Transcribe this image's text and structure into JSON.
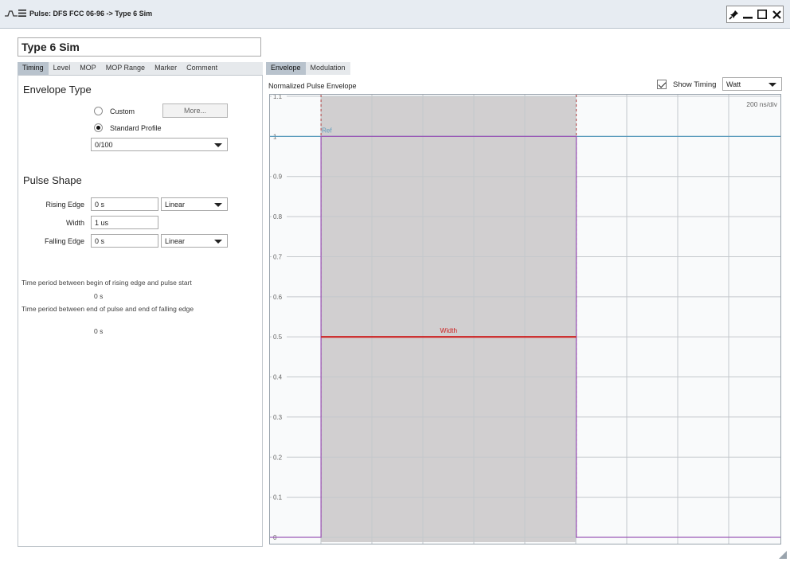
{
  "window": {
    "title": "Pulse: DFS FCC 06-96 -> Type 6 Sim",
    "icons": [
      "pulse-icon",
      "menu-icon",
      "pin-icon",
      "minimize-icon",
      "maximize-icon",
      "close-icon"
    ]
  },
  "pulse_name": "Type 6 Sim",
  "left_tabs": [
    "Timing",
    "Level",
    "MOP",
    "MOP Range",
    "Marker",
    "Comment"
  ],
  "envelope_type": {
    "heading": "Envelope Type",
    "custom_label": "Custom",
    "more_button": "More...",
    "standard_label": "Standard Profile",
    "selected": "Standard Profile",
    "profile_value": "0/100"
  },
  "pulse_shape": {
    "heading": "Pulse Shape",
    "rising_label": "Rising Edge",
    "rising_value": "0 s",
    "rising_shape": "Linear",
    "width_label": "Width",
    "width_value": "1 us",
    "falling_label": "Falling Edge",
    "falling_value": "0 s",
    "falling_shape": "Linear"
  },
  "info": {
    "text1": "Time period between begin of rising edge and pulse start",
    "value1": "0 s",
    "text2": "Time period between end of pulse and end of falling edge",
    "value2": "0 s"
  },
  "right_tabs": [
    "Envelope",
    "Modulation"
  ],
  "chart_header": {
    "title": "Normalized Pulse Envelope",
    "show_timing_label": "Show Timing",
    "show_timing_checked": true,
    "unit_value": "Watt"
  },
  "colors": {
    "accent": "#b9c3cd",
    "envelope": "#9b59b6",
    "ref_line": "#5b9bbd",
    "width_marker": "#cc2222",
    "pulse_fill": "#d1cfd0"
  },
  "chart_data": {
    "type": "line",
    "title": "Normalized Pulse Envelope",
    "time_scale_label": "200 ns/div",
    "ylim": [
      0,
      1.1
    ],
    "yticks": [
      "0",
      "0.1",
      "0.2",
      "0.3",
      "0.4",
      "0.5",
      "0.6",
      "0.7",
      "0.8",
      "0.9",
      "1",
      "1.1"
    ],
    "xdivs": 10,
    "grid": true,
    "ref_label": "Ref",
    "ref_value": 1,
    "width_label": "Width",
    "width_marker_level": 0.5,
    "envelope": [
      {
        "t_ns": 0,
        "v": 0
      },
      {
        "t_ns": 200,
        "v": 0
      },
      {
        "t_ns": 200,
        "v": 1
      },
      {
        "t_ns": 1200,
        "v": 1
      },
      {
        "t_ns": 1200,
        "v": 0
      },
      {
        "t_ns": 2000,
        "v": 0
      }
    ],
    "pulse_start_ns": 200,
    "pulse_end_ns": 1200
  }
}
